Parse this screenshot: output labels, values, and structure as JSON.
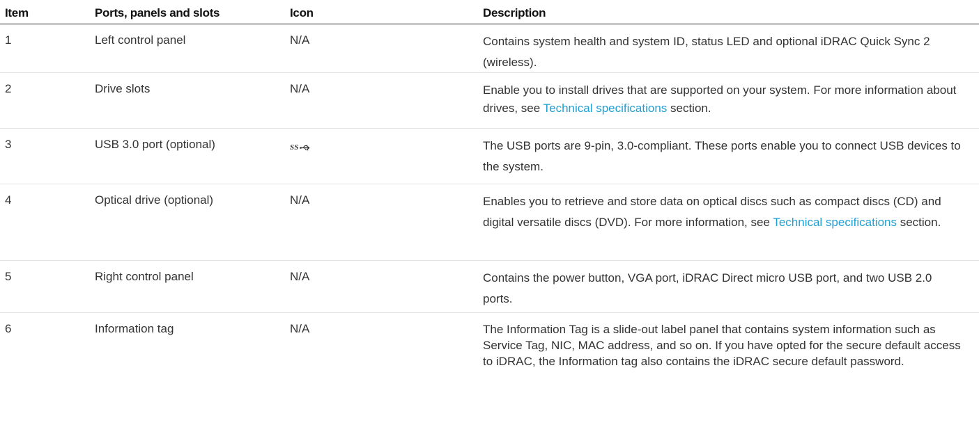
{
  "header": {
    "item": "Item",
    "ports": "Ports, panels and slots",
    "icon": "Icon",
    "description": "Description"
  },
  "rows": [
    {
      "item": "1",
      "name": "Left control panel",
      "icon": "N/A",
      "description": "Contains system health and system ID, status LED and optional iDRAC Quick Sync 2 (wireless)."
    },
    {
      "item": "2",
      "name": "Drive slots",
      "icon": "N/A",
      "description_pre": "Enable you to install drives that are supported on your system. For more information about drives, see ",
      "link": "Technical specifications",
      "description_post": " section."
    },
    {
      "item": "3",
      "name": "USB 3.0 port (optional)",
      "icon_name": "usb-superspeed-icon",
      "icon_text": "SS",
      "description": "The USB ports are 9-pin, 3.0-compliant. These ports enable you to connect USB devices to the system."
    },
    {
      "item": "4",
      "name": "Optical drive (optional)",
      "icon": "N/A",
      "description_pre": "Enables you to retrieve and store data on optical discs such as compact discs (CD) and digital versatile discs (DVD). For more information, see ",
      "link": "Technical specifications",
      "description_post": " section."
    },
    {
      "item": "5",
      "name": "Right control panel",
      "icon": "N/A",
      "description": "Contains the power button, VGA port, iDRAC Direct micro USB port, and two USB 2.0 ports."
    },
    {
      "item": "6",
      "name": "Information tag",
      "icon": "N/A",
      "description": "The Information Tag is a slide-out label panel that contains system information such as Service Tag, NIC, MAC address, and so on. If you have opted for the secure default access to iDRAC, the Information tag also contains the iDRAC secure default password."
    }
  ],
  "colors": {
    "link": "#1f9fd3",
    "header_rule": "#222222"
  }
}
